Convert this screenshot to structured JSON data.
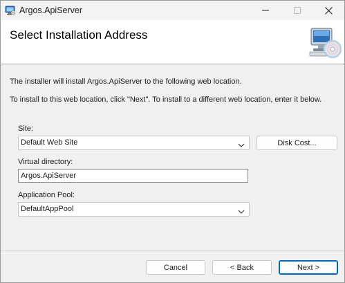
{
  "window": {
    "title": "Argos.ApiServer",
    "app_icon": "installer-icon",
    "controls": {
      "minimize_icon": "minimize-icon",
      "maximize_icon": "maximize-icon",
      "close_icon": "close-icon"
    }
  },
  "banner": {
    "title": "Select Installation Address",
    "icon": "computer-disc-icon"
  },
  "body": {
    "intro": "The installer will install Argos.ApiServer to the following web location.",
    "instructions": "To install to this web location, click \"Next\". To install to a different web location, enter it below."
  },
  "form": {
    "site": {
      "label": "Site:",
      "value": "Default Web Site"
    },
    "virtual_directory": {
      "label": "Virtual directory:",
      "value": "Argos.ApiServer"
    },
    "application_pool": {
      "label": "Application Pool:",
      "value": "DefaultAppPool"
    },
    "disk_cost_label": "Disk Cost..."
  },
  "footer": {
    "cancel_label": "Cancel",
    "back_label": "< Back",
    "next_label": "Next >"
  },
  "colors": {
    "accent": "#0067c0",
    "window_bg": "#f0f0f0",
    "banner_bg": "#ffffff"
  }
}
